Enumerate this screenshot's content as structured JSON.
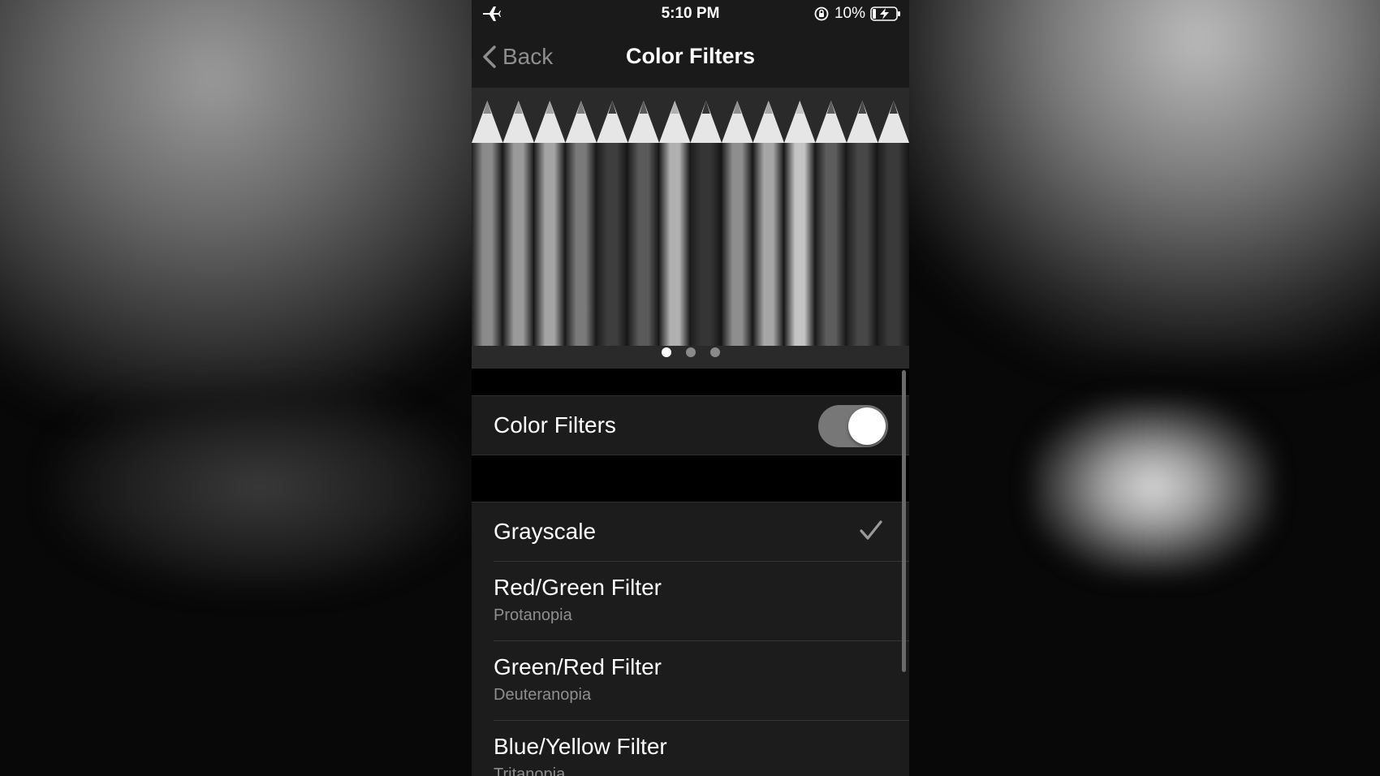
{
  "status_bar": {
    "time": "5:10 PM",
    "battery_percent": "10%",
    "icons": [
      "airplane-icon",
      "orientation-lock-icon",
      "battery-charging-icon"
    ]
  },
  "nav": {
    "back_label": "Back",
    "title": "Color Filters"
  },
  "preview": {
    "pencil_count": 14,
    "page_indicator": {
      "pages": 3,
      "current": 1
    }
  },
  "color_filters_toggle": {
    "label": "Color Filters",
    "on": true
  },
  "filters": [
    {
      "name": "Grayscale",
      "subtitle": "",
      "selected": true
    },
    {
      "name": "Red/Green Filter",
      "subtitle": "Protanopia",
      "selected": false
    },
    {
      "name": "Green/Red Filter",
      "subtitle": "Deuteranopia",
      "selected": false
    },
    {
      "name": "Blue/Yellow Filter",
      "subtitle": "Tritanopia",
      "selected": false
    }
  ]
}
